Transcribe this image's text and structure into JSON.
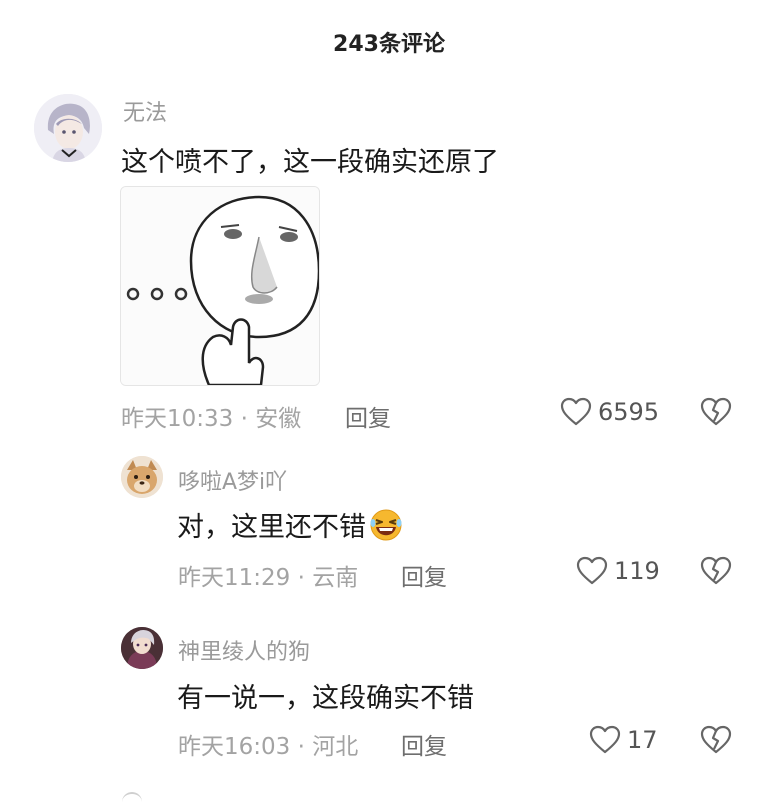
{
  "header": {
    "title": "243条评论"
  },
  "comments": [
    {
      "username": "无法",
      "content": "这个喷不了，这一段确实还原了",
      "time": "昨天10:33",
      "location": "安徽",
      "reply_label": "回复",
      "likes": "6595"
    },
    {
      "username": "哆啦A梦i吖",
      "content": "对，这里还不错",
      "emoji": "laughing-emoji",
      "time": "昨天11:29",
      "location": "云南",
      "reply_label": "回复",
      "likes": "119"
    },
    {
      "username": "神里绫人的狗",
      "content": "有一说一，这段确实不错",
      "time": "昨天16:03",
      "location": "河北",
      "reply_label": "回复",
      "likes": "17"
    }
  ],
  "colors": {
    "meta": "#a3a3a3",
    "username": "#9a9a9a",
    "emoji_face": "#f6b82f"
  }
}
